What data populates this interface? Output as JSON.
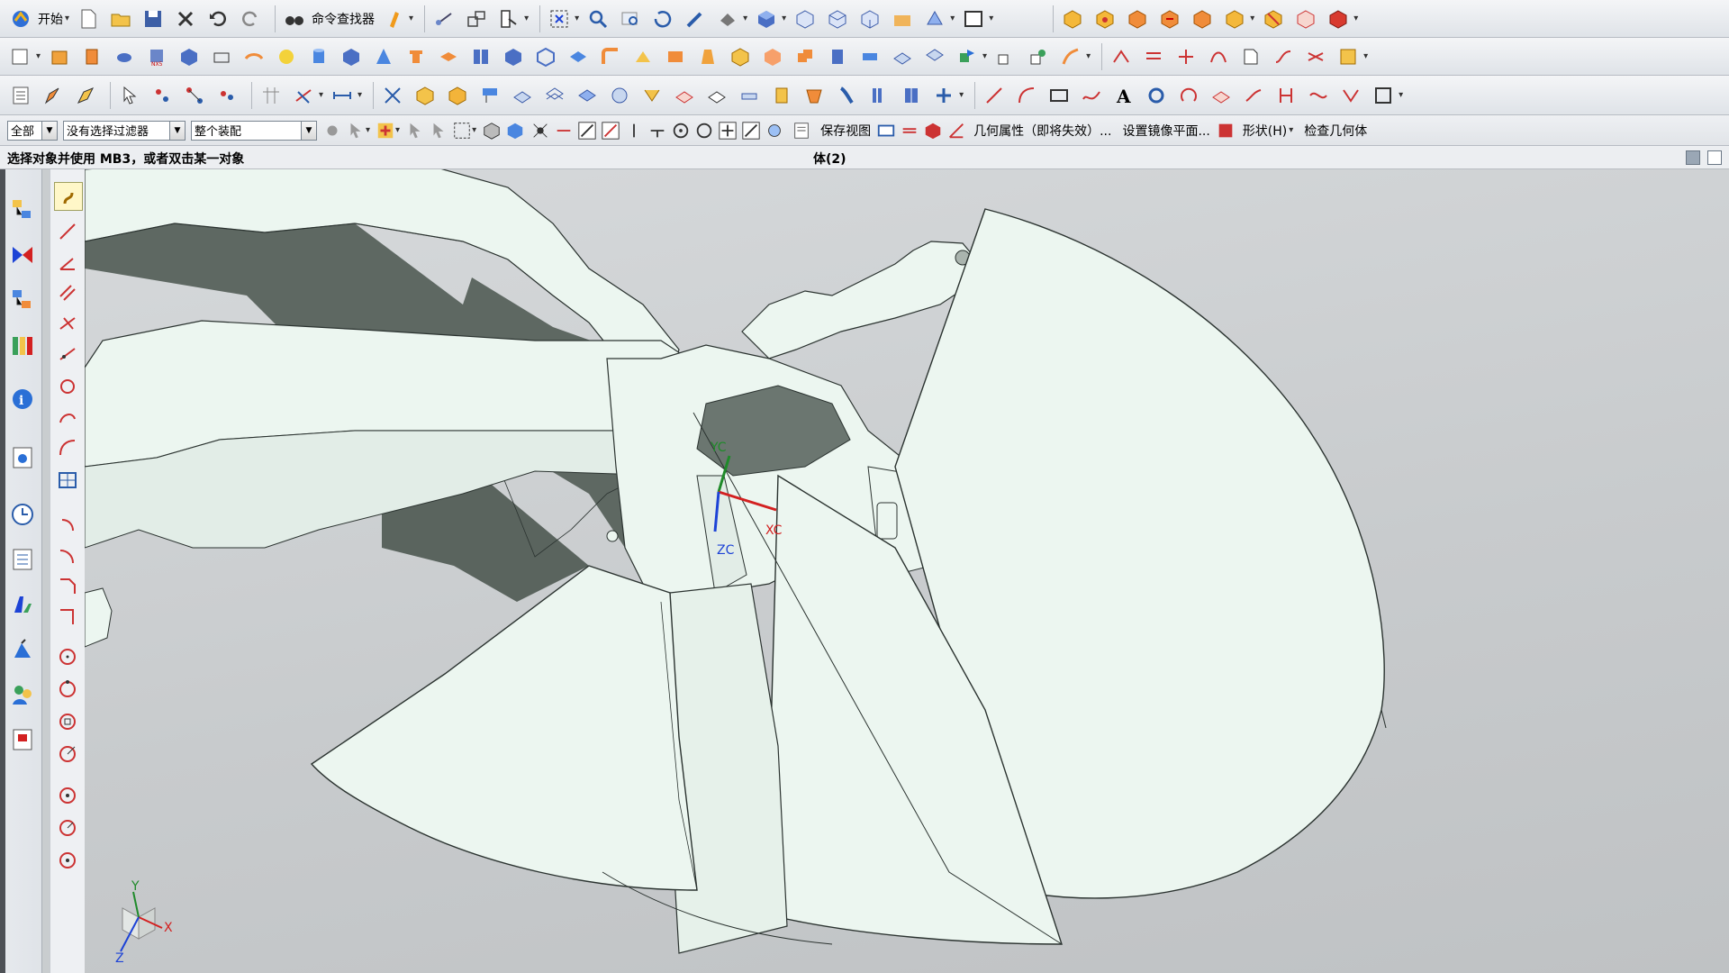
{
  "toolbar_main": {
    "start_label": "开始",
    "command_finder_label": "命令查找器"
  },
  "selection_bar": {
    "filter_scope": "全部",
    "type_filter": "没有选择过滤器",
    "assembly_scope": "整个装配",
    "save_view_label": "保存视图",
    "geometry_props_label": "几何属性（即将失效）...",
    "set_mirror_plane_label": "设置镜像平面...",
    "shape_menu_label": "形状(H)",
    "check_geometry_label": "检查几何体"
  },
  "status": {
    "prompt": "选择对象并使用 MB3，或者双击某一对象",
    "selection_info": "体(2)"
  },
  "viewport": {
    "wcs_labels": {
      "x": "XC",
      "y": "YC",
      "z": "ZC"
    },
    "triad_labels": {
      "x": "X",
      "y": "Y",
      "z": "Z"
    }
  },
  "colors": {
    "part_fill": "#ecf6f0",
    "part_shadow": "#5e6862",
    "part_edge": "#2b3330",
    "x_axis": "#d32020",
    "y_axis": "#1f8a2a",
    "z_axis": "#1d43d6"
  }
}
